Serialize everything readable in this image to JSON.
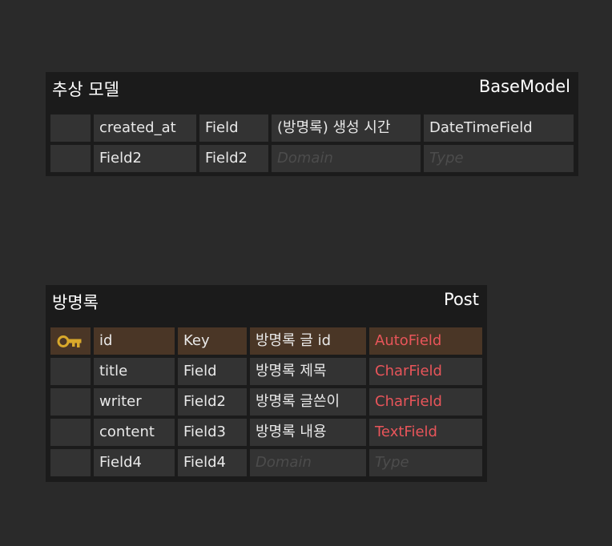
{
  "colors": {
    "background": "#2a2a2a",
    "entity_bg": "#1b1b1b",
    "cell_bg": "#333333",
    "pk_row_bg": "#4a3626",
    "header_text": "#ffffff",
    "cell_text": "#e9e9e9",
    "placeholder_text": "#4c4c4c",
    "data_type_red": "#e8555a",
    "key_icon": "#d8a82b"
  },
  "entities": [
    {
      "logical_name": "추상 모델",
      "physical_name": "BaseModel",
      "columns": [
        {
          "key_icon": "",
          "name": "created_at",
          "logical": "Field",
          "domain": "(방명록) 생성 시간",
          "data_type": "DateTimeField"
        },
        {
          "key_icon": "",
          "name": "Field2",
          "logical": "Field2",
          "domain": "Domain",
          "data_type": "Type"
        }
      ]
    },
    {
      "logical_name": "방명록",
      "physical_name": "Post",
      "columns": [
        {
          "key_icon": "key-icon",
          "name": "id",
          "logical": "Key",
          "domain": "방명록 글 id",
          "data_type": "AutoField"
        },
        {
          "key_icon": "",
          "name": "title",
          "logical": "Field",
          "domain": "방명록 제목",
          "data_type": "CharField"
        },
        {
          "key_icon": "",
          "name": "writer",
          "logical": "Field2",
          "domain": "방명록 글쓴이",
          "data_type": "CharField"
        },
        {
          "key_icon": "",
          "name": "content",
          "logical": "Field3",
          "domain": "방명록 내용",
          "data_type": "TextField"
        },
        {
          "key_icon": "",
          "name": "Field4",
          "logical": "Field4",
          "domain": "Domain",
          "data_type": "Type"
        }
      ]
    }
  ]
}
